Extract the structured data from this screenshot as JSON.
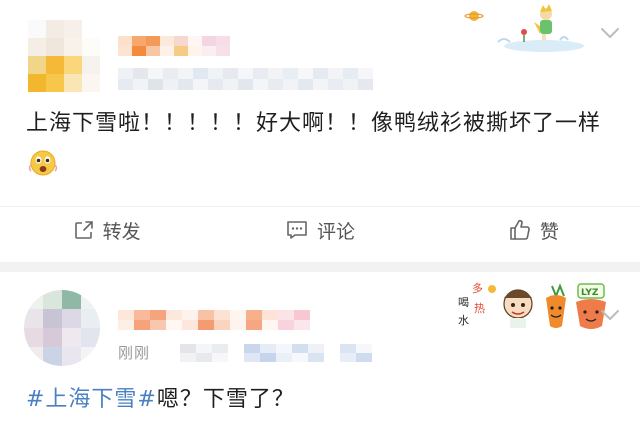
{
  "post1": {
    "text": "上海下雪啦！！！！！好大啊！！像鸭绒衫被撕坏了一样",
    "emoji_icon": "astonished-face-icon",
    "sticker_icon": "little-prince-sticker-icon",
    "actions": {
      "repost": {
        "label": "转发",
        "icon": "share-out-icon"
      },
      "comment": {
        "label": "评论",
        "icon": "comment-icon"
      },
      "like": {
        "label": "赞",
        "icon": "thumbs-up-icon"
      }
    },
    "menu_icon": "chevron-down-icon"
  },
  "post2": {
    "time_label": "刚刚",
    "hashtag": "#上海下雪#",
    "text": "嗯？下雪了？",
    "sticker_icon": "drink-water-cartoon-sticker-icon",
    "sticker_lettering": [
      "多",
      "喝",
      "热",
      "水",
      "LYZ"
    ],
    "menu_icon": "chevron-down-icon"
  },
  "colors": {
    "hashtag": "#4a7fc1",
    "text": "#1e1e1e",
    "muted": "#9a9a9a",
    "separator": "#f2f2f2"
  }
}
